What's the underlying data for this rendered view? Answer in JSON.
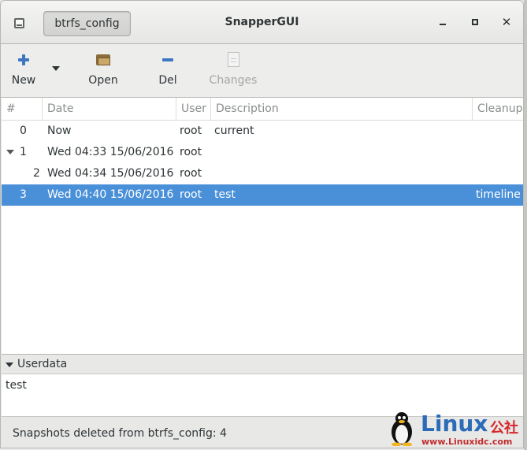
{
  "window": {
    "title": "SnapperGUI",
    "config_button": "btrfs_config",
    "controls": {
      "minimize": "minimize-icon",
      "maximize": "maximize-icon",
      "close": "✕"
    }
  },
  "toolbar": {
    "new_label": "New",
    "open_label": "Open",
    "del_label": "Del",
    "changes_label": "Changes"
  },
  "table": {
    "columns": [
      "#",
      "Date",
      "User",
      "Description",
      "Cleanup"
    ],
    "rows": [
      {
        "num": "0",
        "date": "Now",
        "user": "root",
        "description": "current",
        "cleanup": ""
      },
      {
        "num": "1",
        "date": "Wed 04:33 15/06/2016",
        "user": "root",
        "description": "",
        "cleanup": "",
        "expanded": true
      },
      {
        "num": "2",
        "date": "Wed 04:34 15/06/2016",
        "user": "root",
        "description": "",
        "cleanup": ""
      },
      {
        "num": "3",
        "date": "Wed 04:40 15/06/2016",
        "user": "root",
        "description": "test",
        "cleanup": "timeline",
        "selected": true
      }
    ]
  },
  "userdata": {
    "header": "Userdata",
    "text": "test"
  },
  "status": "Snapshots deleted from btrfs_config: 4",
  "watermark": {
    "brand": "Linux",
    "cn": "公社",
    "url": "www.Linuxidc.com"
  },
  "colors": {
    "selection": "#4a90d9",
    "accent_icon": "#3e76c0",
    "watermark_blue": "#2b6bb8",
    "watermark_red": "#d6282c"
  }
}
